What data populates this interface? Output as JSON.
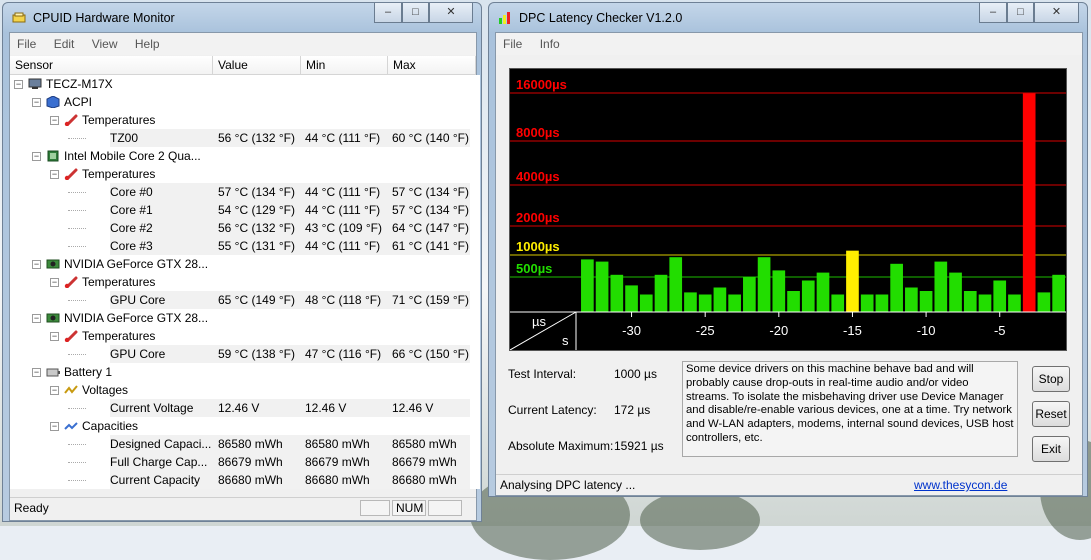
{
  "cpuid": {
    "title": "CPUID Hardware Monitor",
    "window_controls": [
      "–",
      "□",
      "✕"
    ],
    "menu": [
      "File",
      "Edit",
      "View",
      "Help"
    ],
    "columns": [
      "Sensor",
      "Value",
      "Min",
      "Max"
    ],
    "rows": [
      {
        "label": "TECZ-M17X",
        "level": 0,
        "icon": "computer-icon",
        "toggle": "−"
      },
      {
        "label": "ACPI",
        "level": 1,
        "icon": "cube-icon",
        "toggle": "−"
      },
      {
        "label": "Temperatures",
        "level": 2,
        "icon": "thermometer-icon",
        "toggle": "−"
      },
      {
        "label": "TZ00",
        "level": 3,
        "value": "56 °C  (132 °F)",
        "min": "44 °C  (111 °F)",
        "max": "60 °C  (140 °F)"
      },
      {
        "label": "Intel Mobile Core 2 Qua...",
        "level": 1,
        "icon": "chip-icon",
        "toggle": "−"
      },
      {
        "label": "Temperatures",
        "level": 2,
        "icon": "thermometer-icon",
        "toggle": "−"
      },
      {
        "label": "Core #0",
        "level": 3,
        "value": "57 °C  (134 °F)",
        "min": "44 °C  (111 °F)",
        "max": "57 °C  (134 °F)"
      },
      {
        "label": "Core #1",
        "level": 3,
        "value": "54 °C  (129 °F)",
        "min": "44 °C  (111 °F)",
        "max": "57 °C  (134 °F)"
      },
      {
        "label": "Core #2",
        "level": 3,
        "value": "56 °C  (132 °F)",
        "min": "43 °C  (109 °F)",
        "max": "64 °C  (147 °F)"
      },
      {
        "label": "Core #3",
        "level": 3,
        "value": "55 °C  (131 °F)",
        "min": "44 °C  (111 °F)",
        "max": "61 °C  (141 °F)"
      },
      {
        "label": "NVIDIA GeForce GTX 28...",
        "level": 1,
        "icon": "gpu-icon",
        "toggle": "−"
      },
      {
        "label": "Temperatures",
        "level": 2,
        "icon": "thermometer-icon",
        "toggle": "−"
      },
      {
        "label": "GPU Core",
        "level": 3,
        "value": "65 °C  (149 °F)",
        "min": "48 °C  (118 °F)",
        "max": "71 °C  (159 °F)"
      },
      {
        "label": "NVIDIA GeForce GTX 28...",
        "level": 1,
        "icon": "gpu-icon",
        "toggle": "−"
      },
      {
        "label": "Temperatures",
        "level": 2,
        "icon": "thermometer-icon",
        "toggle": "−"
      },
      {
        "label": "GPU Core",
        "level": 3,
        "value": "59 °C  (138 °F)",
        "min": "47 °C  (116 °F)",
        "max": "66 °C  (150 °F)"
      },
      {
        "label": "Battery 1",
        "level": 1,
        "icon": "battery-icon",
        "toggle": "−"
      },
      {
        "label": "Voltages",
        "level": 2,
        "icon": "voltage-icon",
        "toggle": "−"
      },
      {
        "label": "Current Voltage",
        "level": 3,
        "value": "12.46 V",
        "min": "12.46 V",
        "max": "12.46 V"
      },
      {
        "label": "Capacities",
        "level": 2,
        "icon": "capacity-icon",
        "toggle": "−"
      },
      {
        "label": "Designed Capaci...",
        "level": 3,
        "value": "86580 mWh",
        "min": "86580 mWh",
        "max": "86580 mWh"
      },
      {
        "label": "Full Charge Cap...",
        "level": 3,
        "value": "86679 mWh",
        "min": "86679 mWh",
        "max": "86679 mWh"
      },
      {
        "label": "Current Capacity",
        "level": 3,
        "value": "86680 mWh",
        "min": "86680 mWh",
        "max": "86680 mWh"
      }
    ],
    "status": "Ready",
    "status_num": "NUM"
  },
  "dpc": {
    "title": "DPC Latency Checker V1.2.0",
    "window_controls": [
      "–",
      "□",
      "✕"
    ],
    "menu": [
      "File",
      "Info"
    ],
    "stats": {
      "test_interval_label": "Test Interval:",
      "test_interval_value": "1000 µs",
      "current_latency_label": "Current Latency:",
      "current_latency_value": "172 µs",
      "absolute_max_label": "Absolute Maximum:",
      "absolute_max_value": "15921 µs"
    },
    "message": "Some device drivers on this machine behave bad and will probably cause drop-outs in real-time audio and/or video streams. To isolate the misbehaving driver use Device Manager and disable/re-enable various devices, one at a time. Try network and W-LAN adapters, modems, internal sound devices, USB host controllers, etc.",
    "buttons": {
      "stop": "Stop",
      "reset": "Reset",
      "exit": "Exit"
    },
    "status": "Analysing DPC latency ...",
    "link": "www.thesycon.de",
    "colors": {
      "ok": "#22dd00",
      "warn": "#ffee00",
      "bad": "#ff0000",
      "bg": "#000000"
    }
  },
  "chart_data": {
    "type": "bar",
    "title": "",
    "xlabel": "s",
    "ylabel": "µs",
    "y_scale": "nonlinear",
    "y_ticks": [
      "500µs",
      "1000µs",
      "2000µs",
      "4000µs",
      "8000µs",
      "16000µs"
    ],
    "y_tick_values": [
      500,
      1000,
      2000,
      4000,
      8000,
      16000
    ],
    "y_tick_colors": [
      "#22dd00",
      "#ffee00",
      "#ff0000",
      "#ff0000",
      "#ff0000",
      "#ff0000"
    ],
    "x_ticks": [
      "-30",
      "-25",
      "-20",
      "-15",
      "-10",
      "-5"
    ],
    "x_tick_values": [
      -30,
      -25,
      -20,
      -15,
      -10,
      -5
    ],
    "xlim": [
      -33.5,
      -0.5
    ],
    "ylim": [
      0,
      16000
    ],
    "x": [
      -33,
      -32,
      -31,
      -30,
      -29,
      -28,
      -27,
      -26,
      -25,
      -24,
      -23,
      -22,
      -21,
      -20,
      -19,
      -18,
      -17,
      -16,
      -15,
      -14,
      -13,
      -12,
      -11,
      -10,
      -9,
      -8,
      -7,
      -6,
      -5,
      -4,
      -3,
      -2,
      -1
    ],
    "values": [
      900,
      850,
      550,
      380,
      250,
      550,
      950,
      280,
      250,
      350,
      250,
      500,
      950,
      650,
      300,
      450,
      600,
      250,
      1150,
      250,
      250,
      800,
      350,
      300,
      850,
      600,
      300,
      250,
      450,
      250,
      15921,
      280,
      550
    ]
  }
}
